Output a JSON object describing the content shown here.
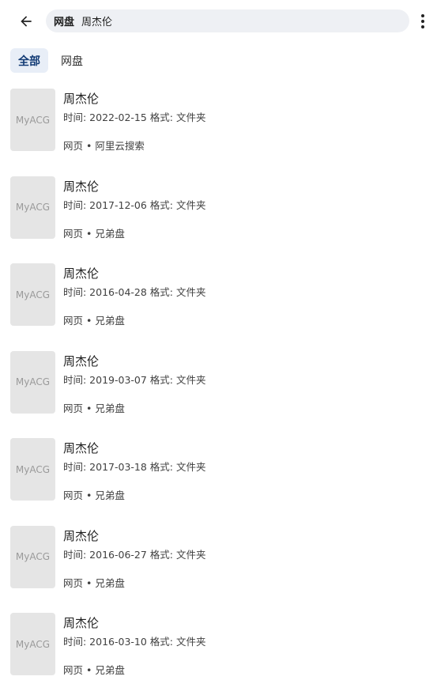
{
  "header": {
    "search_tag": "网盘",
    "search_query": "周杰伦"
  },
  "filters": [
    {
      "label": "全部",
      "active": true
    },
    {
      "label": "网盘",
      "active": false
    }
  ],
  "results": [
    {
      "title": "周杰伦",
      "thumb": "MyACG",
      "meta": "时间: 2022-02-15 格式: 文件夹",
      "source": "网页 • 阿里云搜索"
    },
    {
      "title": "周杰伦",
      "thumb": "MyACG",
      "meta": "时间: 2017-12-06 格式: 文件夹",
      "source": "网页 • 兄弟盘"
    },
    {
      "title": "周杰伦",
      "thumb": "MyACG",
      "meta": "时间: 2016-04-28 格式: 文件夹",
      "source": "网页 • 兄弟盘"
    },
    {
      "title": "周杰伦",
      "thumb": "MyACG",
      "meta": "时间: 2019-03-07 格式: 文件夹",
      "source": "网页 • 兄弟盘"
    },
    {
      "title": "周杰伦",
      "thumb": "MyACG",
      "meta": "时间: 2017-03-18 格式: 文件夹",
      "source": "网页 • 兄弟盘"
    },
    {
      "title": "周杰伦",
      "thumb": "MyACG",
      "meta": "时间: 2016-06-27 格式: 文件夹",
      "source": "网页 • 兄弟盘"
    },
    {
      "title": "周杰伦",
      "thumb": "MyACG",
      "meta": "时间: 2016-03-10 格式: 文件夹",
      "source": "网页 • 兄弟盘"
    }
  ],
  "icons": {
    "back": "arrow-left-icon",
    "more": "more-vertical-icon"
  },
  "colors": {
    "active_chip_bg": "#e8eef7",
    "active_chip_text": "#113a74",
    "search_bg": "#eef0f4",
    "thumb_bg": "#e5e5e5"
  }
}
